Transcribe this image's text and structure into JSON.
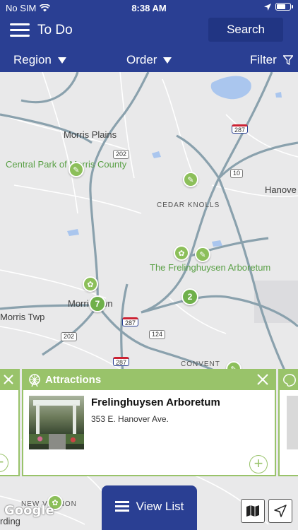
{
  "status_bar": {
    "carrier": "No SIM",
    "time": "8:38 AM"
  },
  "nav": {
    "title": "To Do",
    "search_label": "Search"
  },
  "filter_bar": {
    "region_label": "Region",
    "order_label": "Order",
    "filter_label": "Filter"
  },
  "map": {
    "labels": {
      "morris_plains": "Morris Plains",
      "central_park": "Central Park of Morris County",
      "cedar_knolls": "CEDAR KNOLLS",
      "hanover": "Hanove",
      "frelinghuysen": "The Frelinghuysen Arboretum",
      "morristown": "Morristown",
      "morris_twp": "Morris Twp",
      "convent": "CONVENT",
      "newvernon": "NEW VERNON",
      "harding": "rding"
    },
    "shields": {
      "r287a": "287",
      "r202a": "202",
      "r10": "10",
      "r287b": "287",
      "r124": "124",
      "r202b": "202",
      "r287c": "287"
    },
    "clusters": {
      "morristown": "7",
      "arboretum": "2"
    },
    "attribution": "Google"
  },
  "card": {
    "category": "Attractions",
    "name": "Frelinghuysen Arboretum",
    "address": "353 E. Hanover Ave."
  },
  "bottom": {
    "view_list_label": "View List"
  },
  "colors": {
    "brand_blue": "#2a3f93",
    "accent_green": "#99c36a"
  }
}
